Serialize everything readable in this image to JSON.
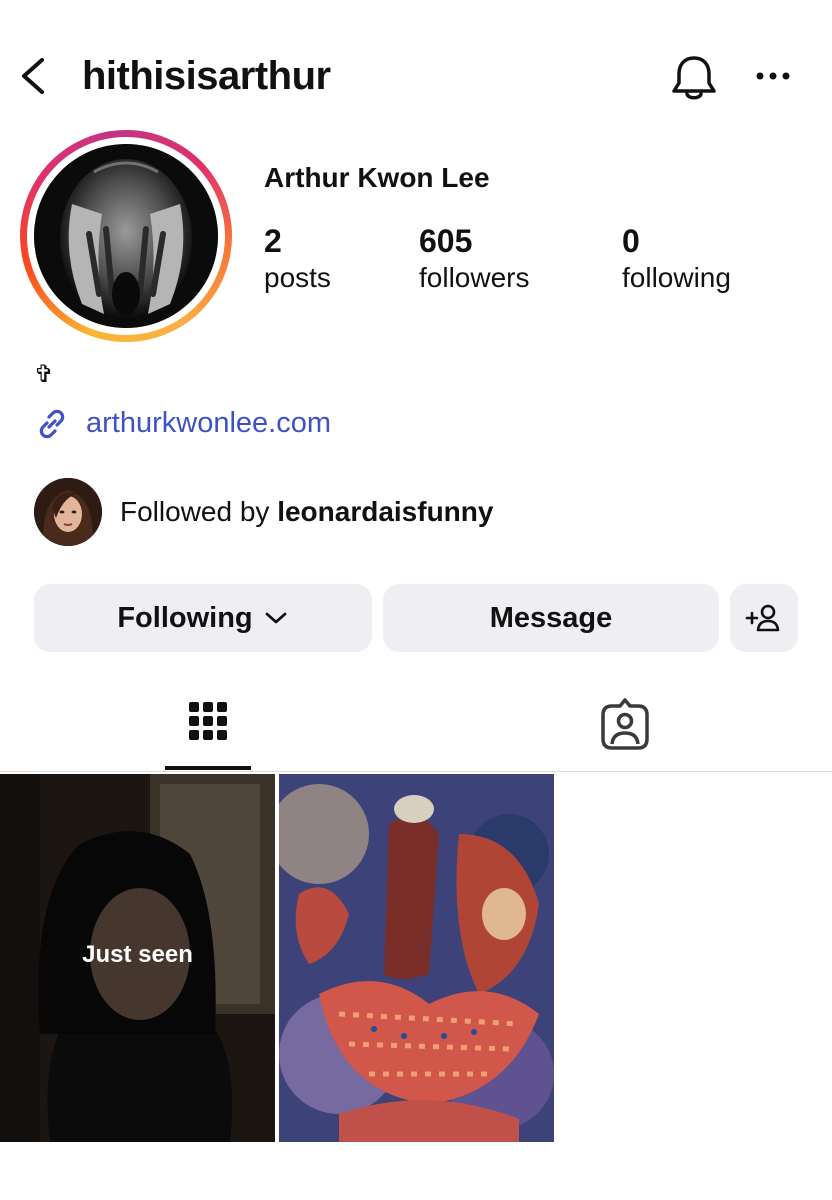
{
  "header": {
    "username": "hithisisarthur",
    "back_icon": "chevron-left-icon",
    "bell_icon": "bell-icon",
    "more_icon": "more-horizontal-icon"
  },
  "profile": {
    "full_name": "Arthur Kwon Lee",
    "stats": [
      {
        "value": "2",
        "label": "posts"
      },
      {
        "value": "605",
        "label": "followers"
      },
      {
        "value": "0",
        "label": "following"
      }
    ],
    "bio": "✞",
    "link_icon": "link-icon",
    "link": "arthurkwonlee.com",
    "story_ring_colors": [
      "#fcaf45",
      "#f77737",
      "#e1306c",
      "#c13584"
    ]
  },
  "followed_by": {
    "prefix": "Followed by ",
    "username": "leonardaisfunny"
  },
  "actions": {
    "following_label": "Following",
    "message_label": "Message",
    "add_user_icon": "add-user-icon"
  },
  "tabs": [
    {
      "name": "grid",
      "icon": "grid-icon",
      "selected": true
    },
    {
      "name": "tagged",
      "icon": "tagged-person-icon",
      "selected": false
    }
  ],
  "posts": [
    {
      "overlay_text": "Just seen"
    },
    {
      "overlay_text": ""
    }
  ],
  "colors": {
    "link": "#3f51c7",
    "button_bg": "#efeff3",
    "text": "#111111"
  }
}
